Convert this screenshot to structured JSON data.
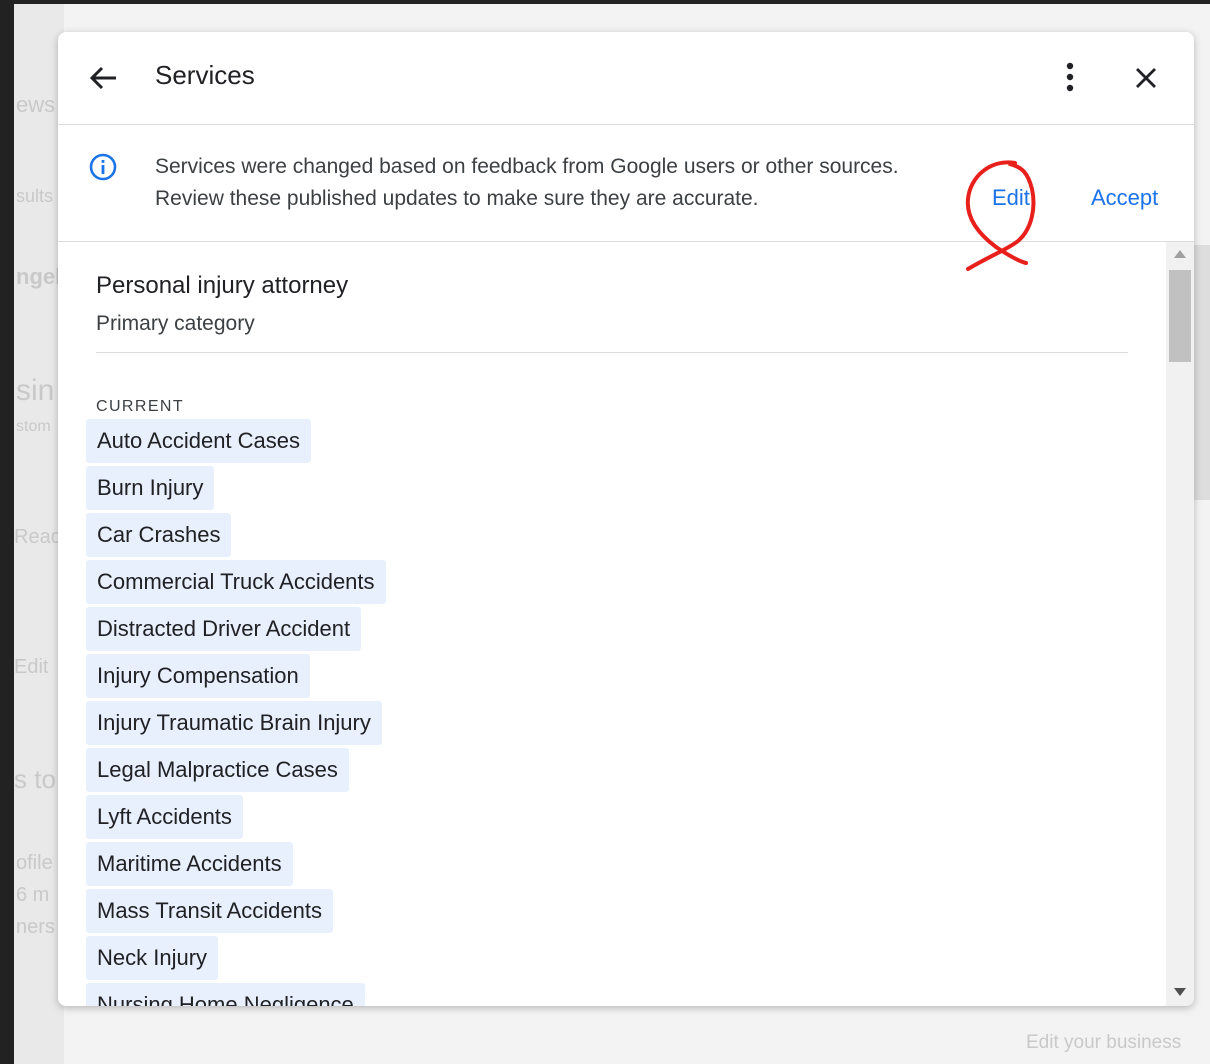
{
  "dialog": {
    "title": "Services",
    "icons": {
      "back": "arrow-back-icon",
      "more": "more-vert-icon",
      "close": "close-icon",
      "info": "info-icon"
    }
  },
  "banner": {
    "text": "Services were changed based on feedback from Google users or other sources. Review these published updates to make sure they are accurate.",
    "edit_label": "Edit",
    "accept_label": "Accept"
  },
  "category": {
    "name": "Personal injury attorney",
    "subtitle": "Primary category"
  },
  "section_label": "CURRENT",
  "services": [
    "Auto Accident Cases",
    "Burn Injury",
    "Car Crashes",
    "Commercial Truck Accidents",
    "Distracted Driver Accident",
    "Injury Compensation",
    "Injury Traumatic Brain Injury",
    "Legal Malpractice Cases",
    "Lyft Accidents",
    "Maritime Accidents",
    "Mass Transit Accidents",
    "Neck Injury",
    "Nursing Home Negligence"
  ],
  "background": {
    "left_fragments": [
      "ews",
      "sults",
      "ngel",
      "sin",
      "stom",
      "Read",
      "Edit",
      "s to",
      "ofile",
      "6 m",
      "ners"
    ],
    "bottom_right": "Edit your business"
  },
  "colors": {
    "accent": "#1a73e8",
    "chip_bg": "#e8f0fe",
    "annotation": "#e8201c"
  }
}
